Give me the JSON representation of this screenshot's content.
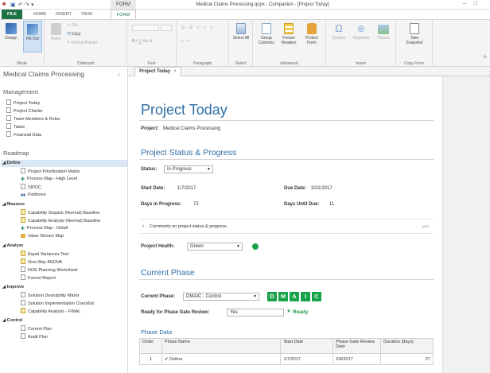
{
  "window": {
    "title": "Medical Claims Processing.qcpx - Companion - [Project Today]",
    "context_tab": "FORM",
    "controls": [
      "–",
      "□"
    ]
  },
  "ribbon_tabs": [
    {
      "label": "FILE"
    },
    {
      "label": "HOME"
    },
    {
      "label": "INSERT"
    },
    {
      "label": "VIEW"
    },
    {
      "label": "FORM"
    }
  ],
  "ribbon": {
    "mode": {
      "label": "Mode",
      "design": "Design",
      "fill_out": "Fill Out"
    },
    "clipboard": {
      "label": "Clipboard",
      "paste": "Paste",
      "cut": "Cut",
      "copy": "Copy",
      "format_painter": "Format Painter"
    },
    "font": {
      "label": "Font",
      "bold": "B",
      "italic": "I",
      "underline": "U",
      "abc": "abc",
      "fontcolor": "A"
    },
    "paragraph": {
      "label": "Paragraph"
    },
    "select": {
      "label": "Select",
      "select_all": "Select All"
    },
    "advanced": {
      "label": "Advanced",
      "group_columns": "Group Columns",
      "freeze_headers": "Freeze Headers",
      "protect_form": "Protect Form"
    },
    "insert": {
      "label": "Insert",
      "symbol": "Symbol",
      "hyperlink": "Hyperlink",
      "picture": "Picture"
    },
    "copy_form": {
      "label": "Copy Form",
      "take_snapshot": "Take Snapshot"
    }
  },
  "sidebar": {
    "title": "Medical Claims Processing",
    "management_heading": "Management",
    "management": [
      "Project Today",
      "Project Charter",
      "Team Members & Roles",
      "Tasks",
      "Financial Data"
    ],
    "roadmap_heading": "Roadmap",
    "phases": [
      {
        "name": "Define",
        "items": [
          "Project Prioritization Matrix",
          "Process Map - High Level",
          "SIPOC",
          "Fishbone"
        ]
      },
      {
        "name": "Measure",
        "items": [
          "Capability Sixpack (Normal) Baseline",
          "Capability Analysis (Normal) Baseline",
          "Process Map - Detail",
          "Value Stream Map"
        ]
      },
      {
        "name": "Analyze",
        "items": [
          "Equal Variances Test",
          "One-Way ANOVA",
          "DOE Planning Worksheet",
          "Funnel Report"
        ]
      },
      {
        "name": "Improve",
        "items": [
          "Solution Desirability Matrix",
          "Solution Implementation Checklist",
          "Capability Analysis - FINAL"
        ]
      },
      {
        "name": "Control",
        "items": [
          "Control Plan",
          "Audit Plan"
        ]
      }
    ]
  },
  "doc_tab": {
    "label": "Project Today",
    "close": "×"
  },
  "form": {
    "title": "Project Today",
    "project_label": "Project:",
    "project_value": "Medical Claims Processing",
    "status_section": "Project Status & Progress",
    "status_label": "Status:",
    "status_value": "In Progress",
    "start_label": "Start Date:",
    "start_value": "1/7/2017",
    "due_label": "Due Date:",
    "due_value": "3/31/2017",
    "days_progress_label": "Days in Progress:",
    "days_progress_value": "72",
    "days_until_label": "Days Until Due:",
    "days_until_value": "11",
    "comments_label": "Comments on project status & progress",
    "comments_link": "open",
    "health_label": "Project Health:",
    "health_value": "Green",
    "phase_section": "Current Phase",
    "current_phase_label": "Current Phase:",
    "current_phase_value": "DMAIC - Control",
    "dmaic": [
      "D",
      "M",
      "A",
      "I",
      "C"
    ],
    "review_label": "Ready for Phase Gate Review:",
    "review_value": "Yes",
    "ready_text": "Ready",
    "phase_data_heading": "Phase Data",
    "table": {
      "headers": [
        "Order",
        "Phase Name",
        "Start Date",
        "Phase Gate Review Date",
        "Duration (days)"
      ],
      "rows": [
        [
          "1",
          "Define",
          "1/7/2017",
          "2/8/2017",
          "27"
        ]
      ]
    }
  },
  "colors": {
    "accent": "#2e6da4",
    "file_tab": "#1e7145",
    "dmaic_green": "#18a24a",
    "selection": "#d9e7f5"
  }
}
